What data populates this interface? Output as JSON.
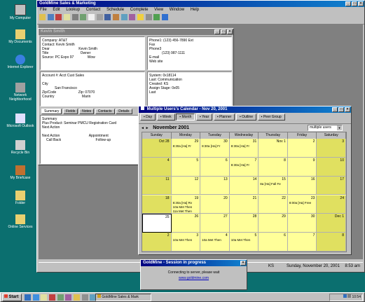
{
  "desktop": {
    "icons": [
      {
        "label": "My Computer",
        "icon": "computer-icon"
      },
      {
        "label": "My Documents",
        "icon": "folder-icon"
      },
      {
        "label": "Internet Explorer",
        "icon": "ie-icon"
      },
      {
        "label": "Network Neighborhood",
        "icon": "network-icon"
      },
      {
        "label": "Microsoft Outlook",
        "icon": "outlook-icon"
      },
      {
        "label": "Recycle Bin",
        "icon": "recycle-bin-icon"
      },
      {
        "label": "My Briefcase",
        "icon": "briefcase-icon"
      },
      {
        "label": "Folder",
        "icon": "folder-icon"
      },
      {
        "label": "Online Services",
        "icon": "folder-icon"
      }
    ]
  },
  "app": {
    "title": "GoldMine Sales & Marketing",
    "menu": [
      "File",
      "Edit",
      "Lookup",
      "Contact",
      "Schedule",
      "Complete",
      "View",
      "Window",
      "Help"
    ]
  },
  "contact_window": {
    "title": "Kevin Smith",
    "company": "Company: AT&T",
    "contact": "Contact: Kevin Smith",
    "dear": "Dear",
    "dear_value": "Kevin Smith",
    "title_label": "Title",
    "title_value": "Owner",
    "source": "Source: PC Expo 97",
    "source_value": "Wow",
    "phone1": "Phone1: (123) 456-7890",
    "ext": "Ext",
    "fax": "Fax",
    "phone3": "Phone3",
    "ext_value": "(123) 987-1111",
    "email": "E-mail",
    "website": "Web site",
    "account_num": "Account #: Acct Cust Sales",
    "city": "City",
    "city_value": "San Francisco",
    "zip": "Zip: 07070",
    "zip_label": "Zip/Code",
    "country": "Country",
    "country_value": "Marin",
    "territory": "Territory",
    "system_label": "System: 0x18114",
    "next_action": "Last: Communication",
    "created_by": "Created: KS",
    "assign": "Assign Stage: 0x05",
    "last": "Last",
    "tabs": [
      "Summary",
      "Fields",
      "Notes",
      "Contacts",
      "Details"
    ],
    "summary_line1": "Summary",
    "summary_line2": "Plus Product: Seminar PMCU Registration Card",
    "summary_line3": "Next Action",
    "next_label": "Next Action",
    "appt_label": "Appointment",
    "next_value": "Call Back",
    "appt_value": "Follow-up"
  },
  "calendar_window": {
    "title": "Multiple Users's Calendar - Nov 20, 2001",
    "toolbar": [
      "Day",
      "Week",
      "Month",
      "Year",
      "Planner",
      "Outline",
      "Peer Group"
    ],
    "month_label": "November 2001",
    "user_select": "multiple users",
    "days": [
      "Sunday",
      "Monday",
      "Tuesday",
      "Wednesday",
      "Thursday",
      "Friday",
      "Saturday"
    ],
    "weeks": [
      [
        {
          "d": "Oct 28",
          "ev": []
        },
        {
          "d": "29",
          "ev": [
            "8:30a [Ha] Fr"
          ]
        },
        {
          "d": "30",
          "ev": [
            "8:30a [Ha] Fr"
          ]
        },
        {
          "d": "31",
          "ev": [
            "8:30a [Ha] Fr"
          ]
        },
        {
          "d": "Nov 1",
          "ev": []
        },
        {
          "d": "2",
          "ev": []
        },
        {
          "d": "3",
          "ev": []
        }
      ],
      [
        {
          "d": "4",
          "ev": []
        },
        {
          "d": "5",
          "ev": []
        },
        {
          "d": "6",
          "ev": []
        },
        {
          "d": "7",
          "ev": [
            "8:30a [Ha] Fr"
          ]
        },
        {
          "d": "8",
          "ev": []
        },
        {
          "d": "9",
          "ev": []
        },
        {
          "d": "10",
          "ev": []
        }
      ],
      [
        {
          "d": "11",
          "ev": []
        },
        {
          "d": "12",
          "ev": []
        },
        {
          "d": "13",
          "ev": []
        },
        {
          "d": "14",
          "ev": []
        },
        {
          "d": "15",
          "ev": [
            "8a [Ha] Fall Fe"
          ]
        },
        {
          "d": "16",
          "ev": []
        },
        {
          "d": "17",
          "ev": []
        }
      ],
      [
        {
          "d": "18",
          "ev": []
        },
        {
          "d": "19",
          "ev": [
            "8:30a [Ha] Rv",
            "10a Met Then",
            "11a Met Then"
          ]
        },
        {
          "d": "20",
          "ev": []
        },
        {
          "d": "21",
          "ev": []
        },
        {
          "d": "22",
          "ev": []
        },
        {
          "d": "23",
          "ev": [
            "8:00a [Ha] Free"
          ]
        },
        {
          "d": "24",
          "ev": []
        }
      ],
      [
        {
          "d": "25",
          "ev": []
        },
        {
          "d": "26",
          "ev": []
        },
        {
          "d": "27",
          "ev": []
        },
        {
          "d": "28",
          "ev": []
        },
        {
          "d": "29",
          "ev": []
        },
        {
          "d": "30",
          "ev": []
        },
        {
          "d": "Dec 1",
          "ev": []
        }
      ],
      [
        {
          "d": "2",
          "ev": []
        },
        {
          "d": "3",
          "ev": [
            "10a Met Then"
          ]
        },
        {
          "d": "4",
          "ev": [
            "10a Met Then"
          ]
        },
        {
          "d": "5",
          "ev": [
            "10a Met Then"
          ]
        },
        {
          "d": "6",
          "ev": []
        },
        {
          "d": "7",
          "ev": []
        },
        {
          "d": "8",
          "ev": []
        }
      ]
    ]
  },
  "popup": {
    "title": "GoldMine - Session in progress",
    "line1": "Connecting to server, please wait",
    "link": "www.goldmine.com"
  },
  "statusbar": {
    "left": "",
    "user": "KS",
    "date": "Sunday, November 20, 2001",
    "time": "8:53 am"
  },
  "taskbar": {
    "start": "Start",
    "task": "GoldMine Sales & Mark",
    "clock": "10:54"
  },
  "colors": {
    "desktop": "#0b6f6f",
    "calendar_weekday": "#ffff99",
    "calendar_weekend": "#e0e060"
  }
}
